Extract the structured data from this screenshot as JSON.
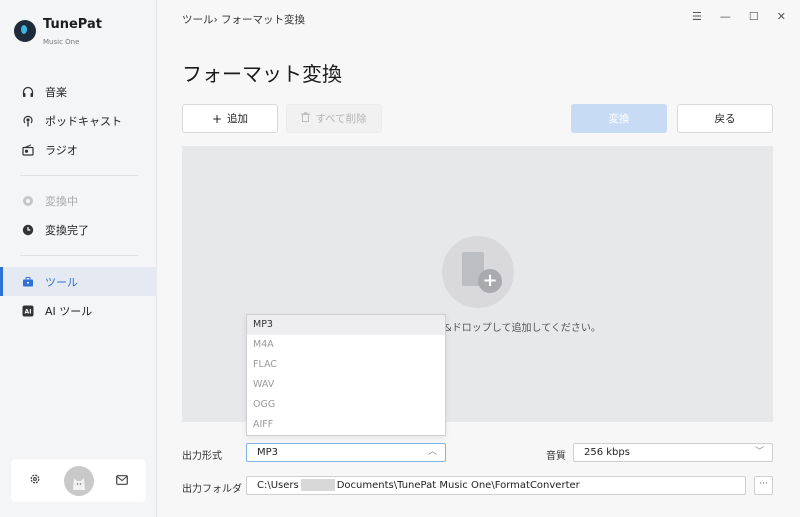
{
  "app": {
    "name": "TunePat",
    "subtitle": "Music One"
  },
  "sidebar": {
    "items": [
      {
        "label": "音楽",
        "icon": "headphones-icon"
      },
      {
        "label": "ポッドキャスト",
        "icon": "podcast-icon"
      },
      {
        "label": "ラジオ",
        "icon": "radio-icon"
      },
      {
        "label": "変換中",
        "icon": "converting-icon"
      },
      {
        "label": "変換完了",
        "icon": "clock-icon"
      },
      {
        "label": "ツール",
        "icon": "toolbox-icon"
      },
      {
        "label": "AI ツール",
        "icon": "ai-icon"
      }
    ],
    "active_color": "#2f6fd6"
  },
  "header": {
    "breadcrumb_root": "ツール",
    "breadcrumb_sep": "›",
    "breadcrumb_current": "フォーマット変換",
    "page_title": "フォーマット変換"
  },
  "toolbar": {
    "add_label": "追加",
    "clear_label": "すべて削除",
    "convert_label": "変換",
    "back_label": "戻る"
  },
  "dropzone": {
    "text": "&ドロップして追加してください。"
  },
  "format_dropdown": {
    "options": [
      "MP3",
      "M4A",
      "FLAC",
      "WAV",
      "OGG",
      "AIFF"
    ],
    "selected": "MP3"
  },
  "settings": {
    "output_format_label": "出力形式",
    "output_format_value": "MP3",
    "quality_label": "音質",
    "quality_value": "256 kbps",
    "output_folder_label": "出力フォルダ",
    "output_folder_prefix": "C:\\Users",
    "output_folder_suffix": "Documents\\TunePat Music One\\FormatConverter",
    "more_button": "···"
  }
}
